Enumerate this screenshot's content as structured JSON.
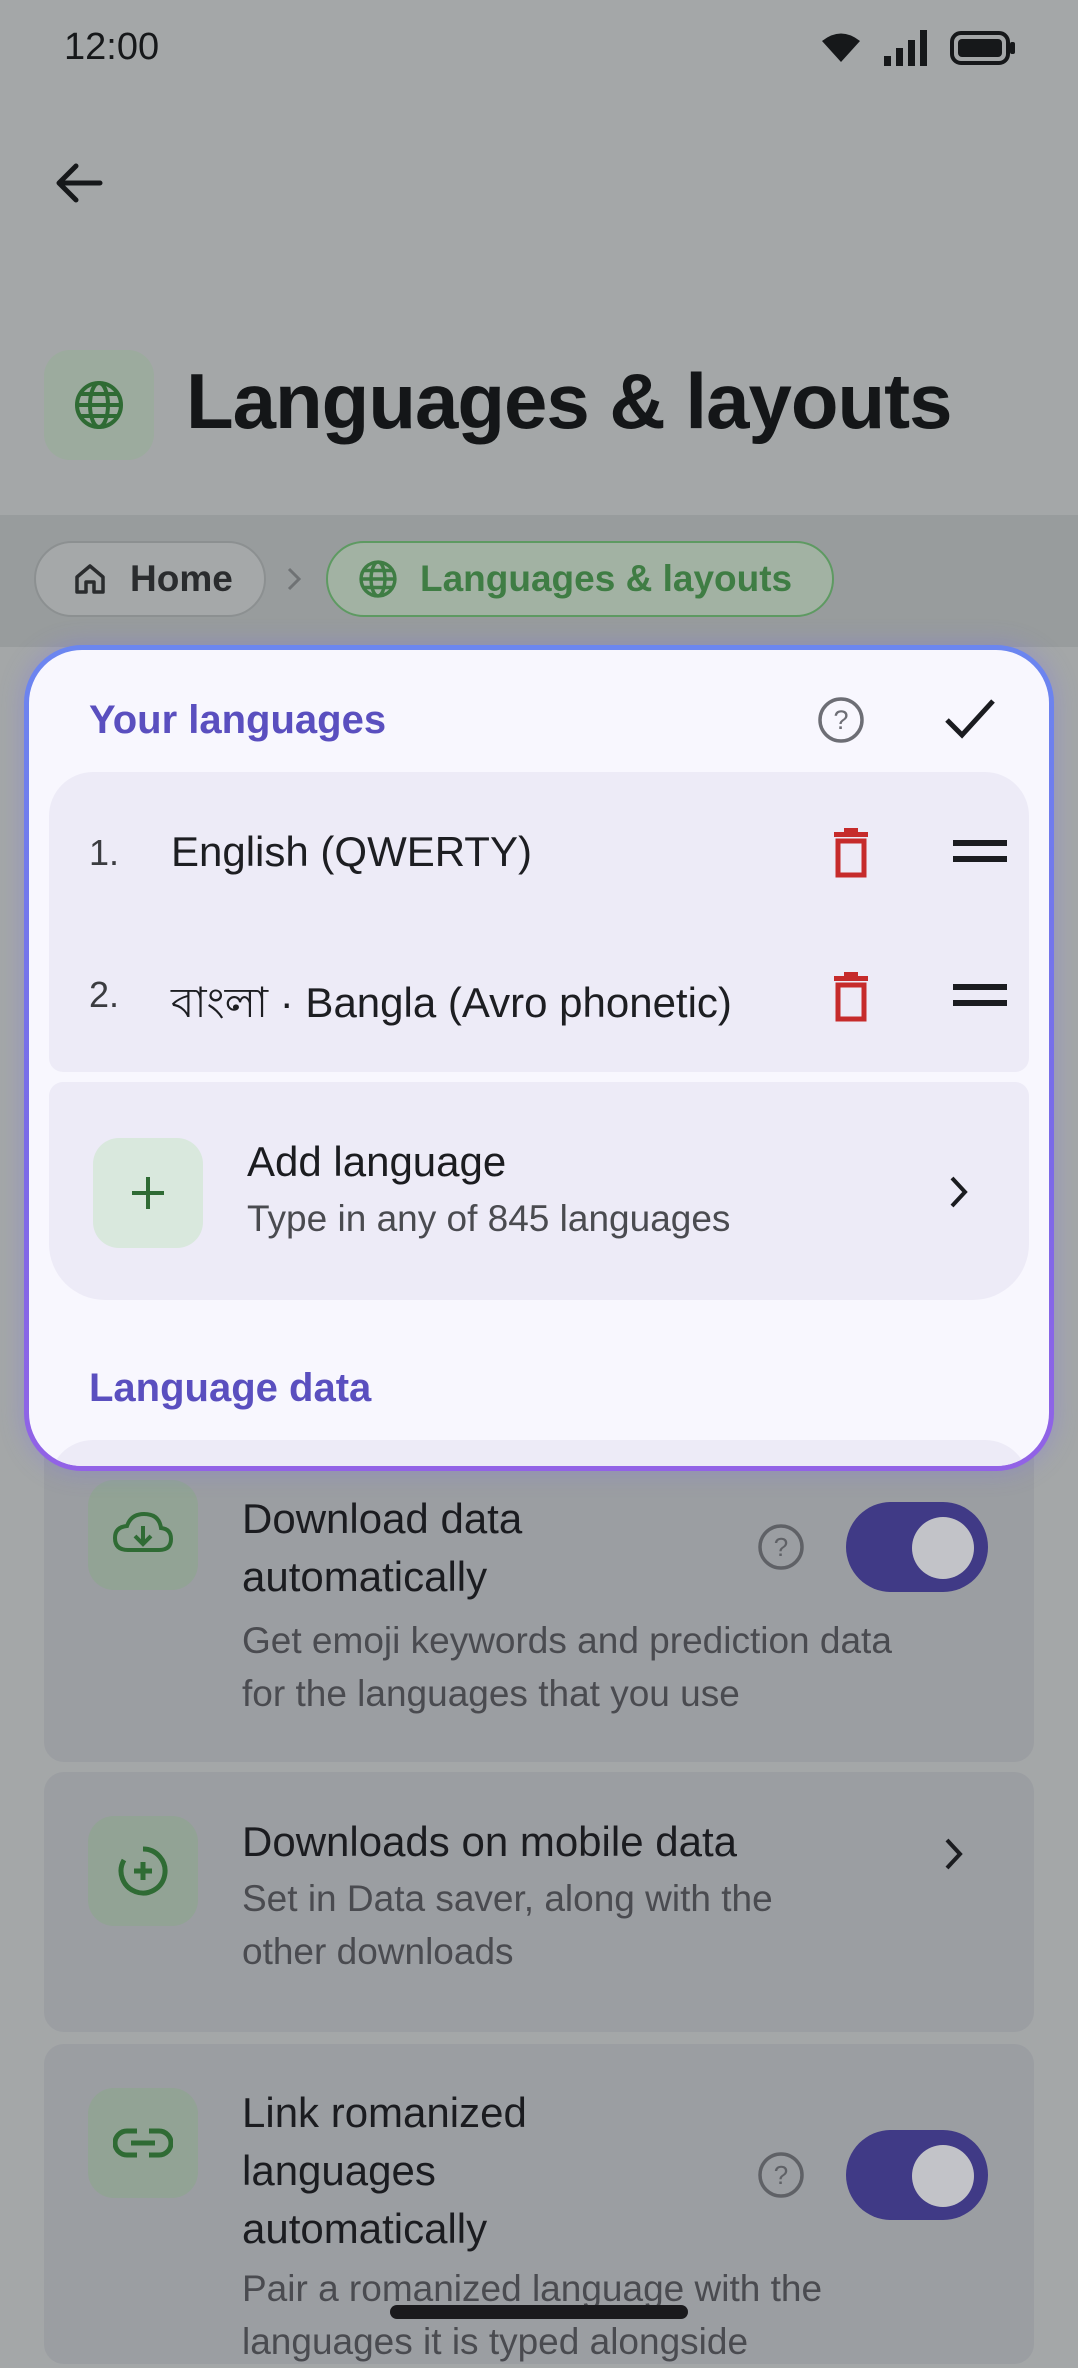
{
  "status_bar": {
    "time": "12:00"
  },
  "header": {
    "title": "Languages & layouts"
  },
  "breadcrumb": {
    "home": "Home",
    "current": "Languages & layouts"
  },
  "panel": {
    "languages_title": "Your languages",
    "languages": [
      {
        "num": "1.",
        "name": "English (QWERTY)"
      },
      {
        "num": "2.",
        "name": "বাংলা · Bangla (Avro phonetic)"
      }
    ],
    "add_language": {
      "title": "Add language",
      "subtitle": "Type in any of 845 languages"
    },
    "language_data_title": "Language data"
  },
  "settings": {
    "download": {
      "title": "Download data automatically",
      "title_l1": "Download data",
      "title_l2": "automatically",
      "sub_l1": "Get emoji keywords and prediction data",
      "sub_l2": "for the languages that you use",
      "enabled": true
    },
    "mobile": {
      "title": "Downloads on mobile data",
      "sub_l1": "Set in Data saver, along with the",
      "sub_l2": "other downloads"
    },
    "romanized": {
      "title_l1": "Link romanized",
      "title_l2": "languages",
      "title_l3": "automatically",
      "sub_l1": "Pair a romanized language with the",
      "sub_l2": "languages it is typed alongside",
      "enabled": true
    }
  },
  "colors": {
    "accent": "#5a4fbf",
    "toggle_on": "#403a86",
    "green": "#3f7d44",
    "delete": "#c62b2b"
  }
}
